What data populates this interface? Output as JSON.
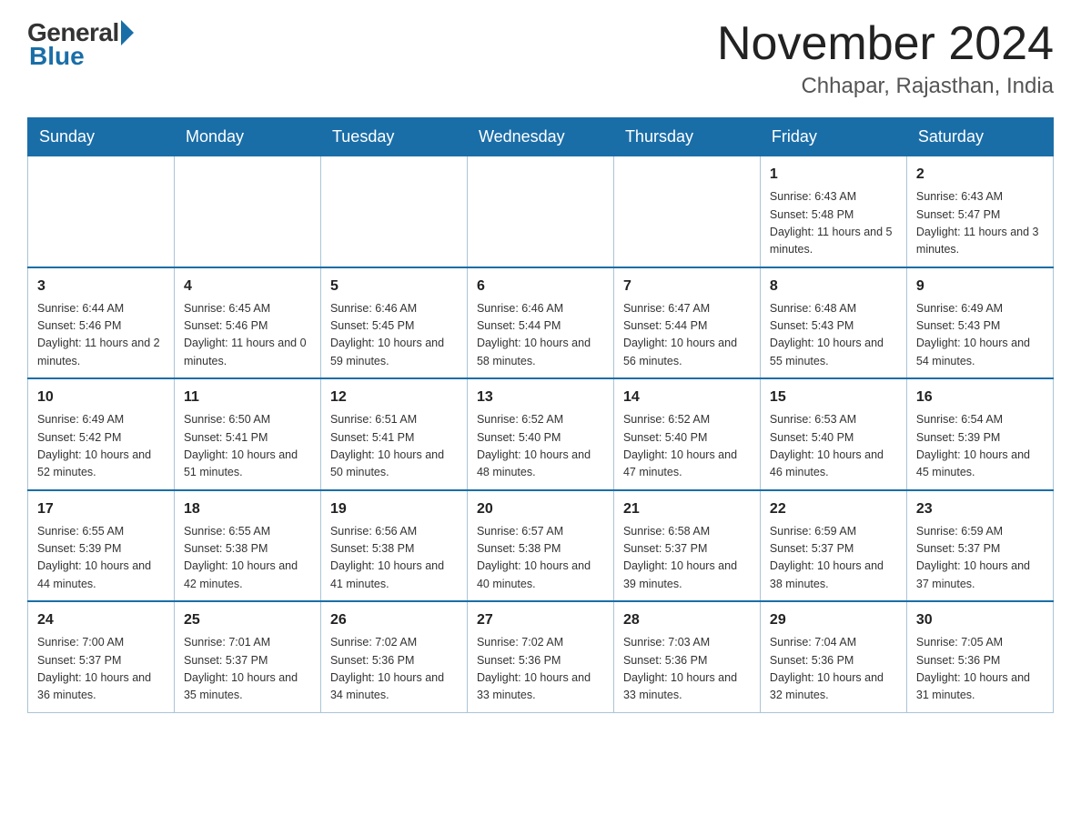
{
  "header": {
    "logo": {
      "general": "General",
      "blue": "Blue"
    },
    "title": "November 2024",
    "location": "Chhapar, Rajasthan, India"
  },
  "weekdays": [
    "Sunday",
    "Monday",
    "Tuesday",
    "Wednesday",
    "Thursday",
    "Friday",
    "Saturday"
  ],
  "weeks": [
    [
      {
        "day": "",
        "info": ""
      },
      {
        "day": "",
        "info": ""
      },
      {
        "day": "",
        "info": ""
      },
      {
        "day": "",
        "info": ""
      },
      {
        "day": "",
        "info": ""
      },
      {
        "day": "1",
        "info": "Sunrise: 6:43 AM\nSunset: 5:48 PM\nDaylight: 11 hours and 5 minutes."
      },
      {
        "day": "2",
        "info": "Sunrise: 6:43 AM\nSunset: 5:47 PM\nDaylight: 11 hours and 3 minutes."
      }
    ],
    [
      {
        "day": "3",
        "info": "Sunrise: 6:44 AM\nSunset: 5:46 PM\nDaylight: 11 hours and 2 minutes."
      },
      {
        "day": "4",
        "info": "Sunrise: 6:45 AM\nSunset: 5:46 PM\nDaylight: 11 hours and 0 minutes."
      },
      {
        "day": "5",
        "info": "Sunrise: 6:46 AM\nSunset: 5:45 PM\nDaylight: 10 hours and 59 minutes."
      },
      {
        "day": "6",
        "info": "Sunrise: 6:46 AM\nSunset: 5:44 PM\nDaylight: 10 hours and 58 minutes."
      },
      {
        "day": "7",
        "info": "Sunrise: 6:47 AM\nSunset: 5:44 PM\nDaylight: 10 hours and 56 minutes."
      },
      {
        "day": "8",
        "info": "Sunrise: 6:48 AM\nSunset: 5:43 PM\nDaylight: 10 hours and 55 minutes."
      },
      {
        "day": "9",
        "info": "Sunrise: 6:49 AM\nSunset: 5:43 PM\nDaylight: 10 hours and 54 minutes."
      }
    ],
    [
      {
        "day": "10",
        "info": "Sunrise: 6:49 AM\nSunset: 5:42 PM\nDaylight: 10 hours and 52 minutes."
      },
      {
        "day": "11",
        "info": "Sunrise: 6:50 AM\nSunset: 5:41 PM\nDaylight: 10 hours and 51 minutes."
      },
      {
        "day": "12",
        "info": "Sunrise: 6:51 AM\nSunset: 5:41 PM\nDaylight: 10 hours and 50 minutes."
      },
      {
        "day": "13",
        "info": "Sunrise: 6:52 AM\nSunset: 5:40 PM\nDaylight: 10 hours and 48 minutes."
      },
      {
        "day": "14",
        "info": "Sunrise: 6:52 AM\nSunset: 5:40 PM\nDaylight: 10 hours and 47 minutes."
      },
      {
        "day": "15",
        "info": "Sunrise: 6:53 AM\nSunset: 5:40 PM\nDaylight: 10 hours and 46 minutes."
      },
      {
        "day": "16",
        "info": "Sunrise: 6:54 AM\nSunset: 5:39 PM\nDaylight: 10 hours and 45 minutes."
      }
    ],
    [
      {
        "day": "17",
        "info": "Sunrise: 6:55 AM\nSunset: 5:39 PM\nDaylight: 10 hours and 44 minutes."
      },
      {
        "day": "18",
        "info": "Sunrise: 6:55 AM\nSunset: 5:38 PM\nDaylight: 10 hours and 42 minutes."
      },
      {
        "day": "19",
        "info": "Sunrise: 6:56 AM\nSunset: 5:38 PM\nDaylight: 10 hours and 41 minutes."
      },
      {
        "day": "20",
        "info": "Sunrise: 6:57 AM\nSunset: 5:38 PM\nDaylight: 10 hours and 40 minutes."
      },
      {
        "day": "21",
        "info": "Sunrise: 6:58 AM\nSunset: 5:37 PM\nDaylight: 10 hours and 39 minutes."
      },
      {
        "day": "22",
        "info": "Sunrise: 6:59 AM\nSunset: 5:37 PM\nDaylight: 10 hours and 38 minutes."
      },
      {
        "day": "23",
        "info": "Sunrise: 6:59 AM\nSunset: 5:37 PM\nDaylight: 10 hours and 37 minutes."
      }
    ],
    [
      {
        "day": "24",
        "info": "Sunrise: 7:00 AM\nSunset: 5:37 PM\nDaylight: 10 hours and 36 minutes."
      },
      {
        "day": "25",
        "info": "Sunrise: 7:01 AM\nSunset: 5:37 PM\nDaylight: 10 hours and 35 minutes."
      },
      {
        "day": "26",
        "info": "Sunrise: 7:02 AM\nSunset: 5:36 PM\nDaylight: 10 hours and 34 minutes."
      },
      {
        "day": "27",
        "info": "Sunrise: 7:02 AM\nSunset: 5:36 PM\nDaylight: 10 hours and 33 minutes."
      },
      {
        "day": "28",
        "info": "Sunrise: 7:03 AM\nSunset: 5:36 PM\nDaylight: 10 hours and 33 minutes."
      },
      {
        "day": "29",
        "info": "Sunrise: 7:04 AM\nSunset: 5:36 PM\nDaylight: 10 hours and 32 minutes."
      },
      {
        "day": "30",
        "info": "Sunrise: 7:05 AM\nSunset: 5:36 PM\nDaylight: 10 hours and 31 minutes."
      }
    ]
  ]
}
